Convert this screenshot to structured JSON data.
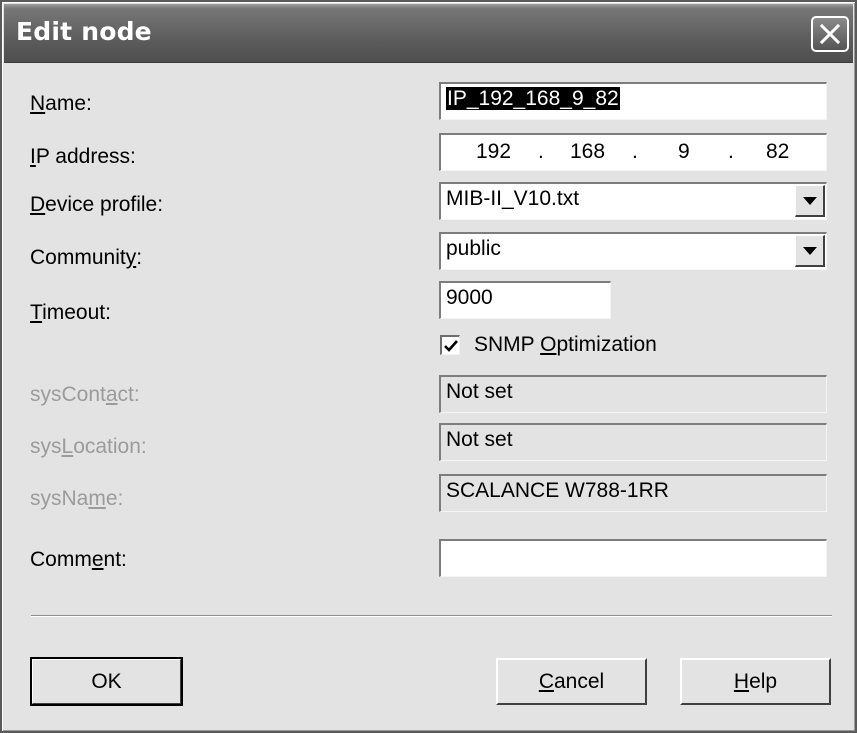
{
  "window": {
    "title": "Edit node"
  },
  "labels": {
    "name_pre": "",
    "name_key": "N",
    "name_post": "ame:",
    "ip_pre": "",
    "ip_key": "I",
    "ip_post": "P address:",
    "profile_pre": "",
    "profile_key": "D",
    "profile_post": "evice profile:",
    "community_pre": "Communit",
    "community_key": "y",
    "community_post": ":",
    "timeout_pre": "",
    "timeout_key": "T",
    "timeout_post": "imeout:",
    "syscontact_pre": "sysCont",
    "syscontact_key": "a",
    "syscontact_post": "ct:",
    "syslocation_pre": "sys",
    "syslocation_key": "L",
    "syslocation_post": "ocation:",
    "sysname_pre": "sysNa",
    "sysname_key": "m",
    "sysname_post": "e:",
    "comment_pre": "Comm",
    "comment_key": "e",
    "comment_post": "nt:"
  },
  "fields": {
    "name_value": "IP_192_168_9_82",
    "ip_octets": [
      "192",
      "168",
      "9",
      "82"
    ],
    "ip_dot": ".",
    "device_profile": "MIB-II_V10.txt",
    "community": "public",
    "timeout": "9000",
    "syscontact": "Not set",
    "syslocation": "Not set",
    "sysname": "SCALANCE W788-1RR",
    "comment": ""
  },
  "snmp_optimization": {
    "checked": true,
    "label_pre": "SNMP ",
    "label_key": "O",
    "label_post": "ptimization"
  },
  "buttons": {
    "ok": "OK",
    "cancel_key": "C",
    "cancel_post": "ancel",
    "help_key": "H",
    "help_post": "elp"
  },
  "icons": {
    "close": "close-icon",
    "dropdown": "chevron-down-icon",
    "check": "checkmark-icon"
  }
}
